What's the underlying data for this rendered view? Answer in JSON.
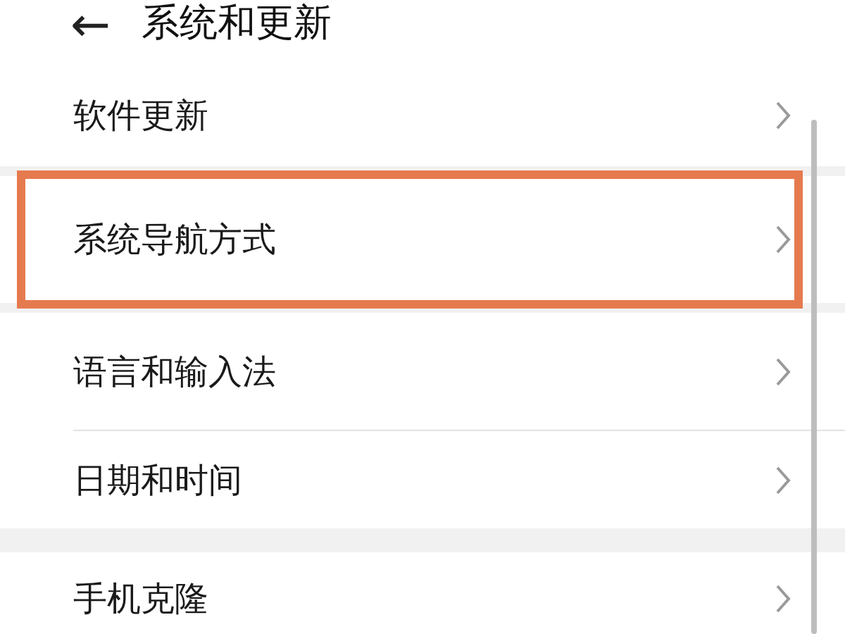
{
  "header": {
    "back": "←",
    "title": "系统和更新"
  },
  "groups": [
    {
      "items": [
        {
          "label": "软件更新",
          "highlighted": false
        }
      ]
    },
    {
      "items": [
        {
          "label": "系统导航方式",
          "highlighted": true
        }
      ]
    },
    {
      "items": [
        {
          "label": "语言和输入法",
          "highlighted": false
        },
        {
          "label": "日期和时间",
          "highlighted": false
        }
      ]
    },
    {
      "items": [
        {
          "label": "手机克隆",
          "highlighted": false
        }
      ]
    }
  ]
}
